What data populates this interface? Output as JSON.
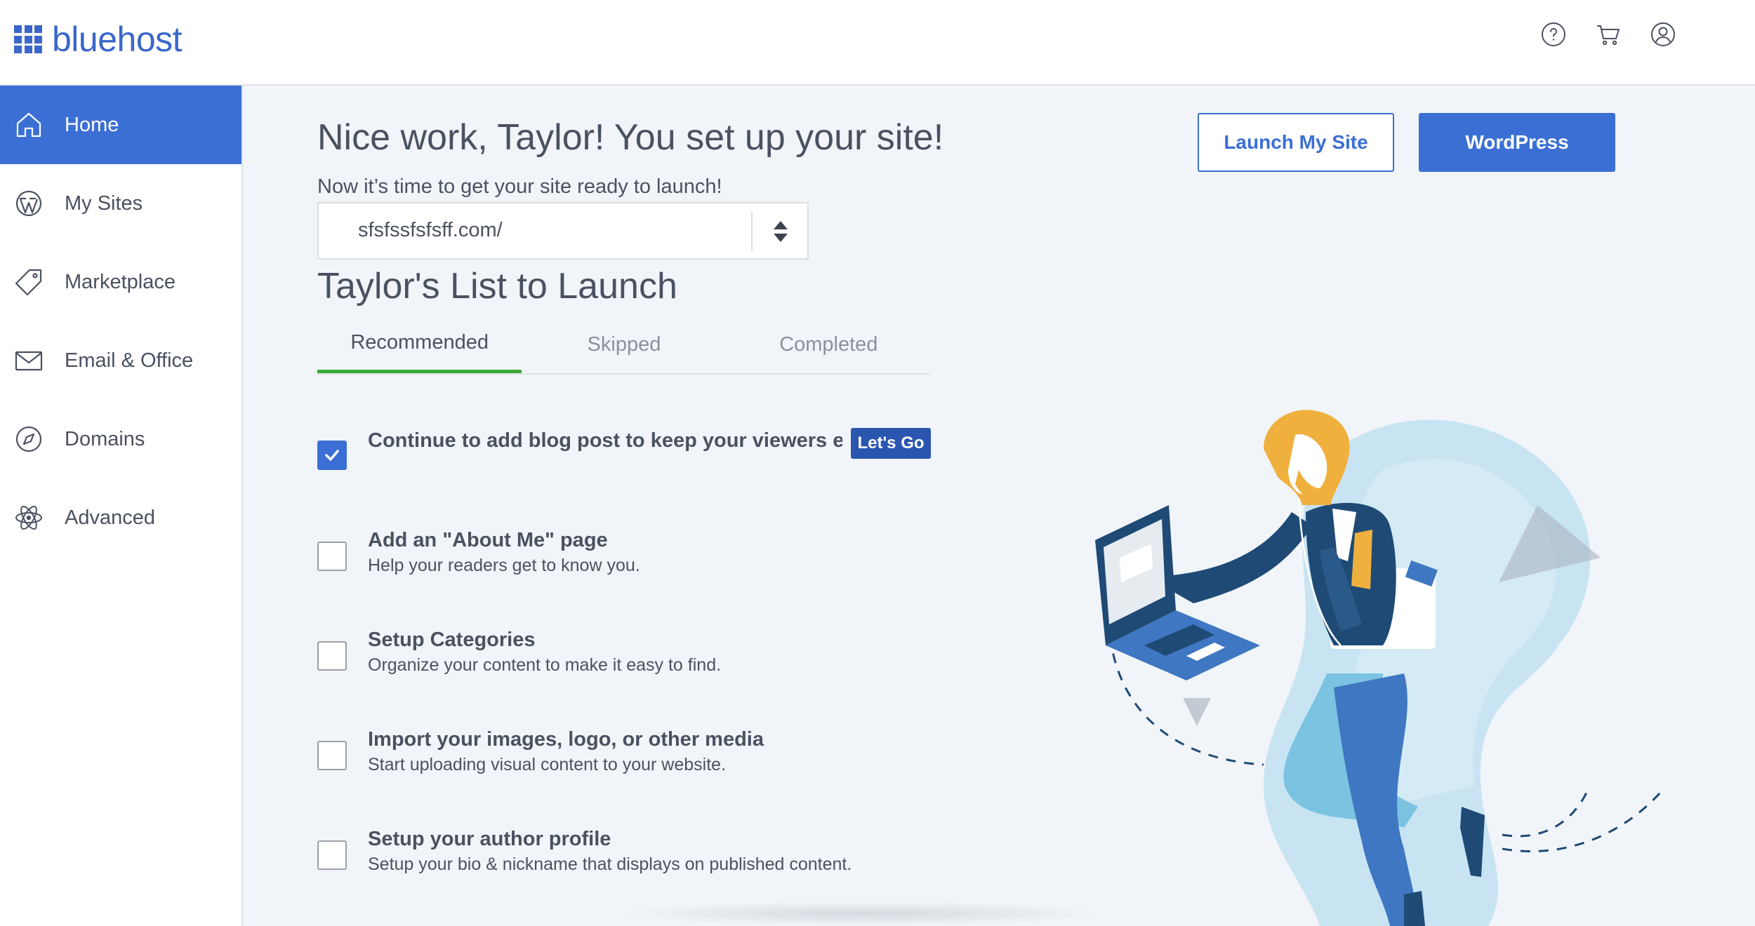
{
  "brand": {
    "name": "bluehost",
    "color": "#3a67c9"
  },
  "header": {
    "icons": [
      "help-icon",
      "cart-icon",
      "account-icon"
    ]
  },
  "sidebar": {
    "items": [
      {
        "label": "Home",
        "icon": "home-icon",
        "active": true
      },
      {
        "label": "My Sites",
        "icon": "wordpress-icon",
        "active": false
      },
      {
        "label": "Marketplace",
        "icon": "tag-icon",
        "active": false
      },
      {
        "label": "Email & Office",
        "icon": "mail-icon",
        "active": false
      },
      {
        "label": "Domains",
        "icon": "compass-icon",
        "active": false
      },
      {
        "label": "Advanced",
        "icon": "atom-icon",
        "active": false
      }
    ]
  },
  "main": {
    "title": "Nice work, Taylor! You set up your site!",
    "subtitle": "Now it’s time to get your site ready to launch!",
    "site_select": {
      "value": "sfsfssfsfsff.com/"
    },
    "buttons": {
      "launch": "Launch My Site",
      "wordpress": "WordPress"
    },
    "list_title": "Taylor's List to Launch",
    "tabs": [
      {
        "label": "Recommended",
        "active": true
      },
      {
        "label": "Skipped",
        "active": false
      },
      {
        "label": "Completed",
        "active": false
      }
    ],
    "tasks": [
      {
        "title": "Continue to add blog post to keep your viewers engaged",
        "description": "",
        "checked": true,
        "action": "Let's Go"
      },
      {
        "title": "Add an \"About Me\" page",
        "description": "Help your readers get to know you.",
        "checked": false
      },
      {
        "title": "Setup Categories",
        "description": "Organize your content to make it easy to find.",
        "checked": false
      },
      {
        "title": "Import your images, logo, or other media",
        "description": "Start uploading visual content to your website.",
        "checked": false
      },
      {
        "title": "Setup your author profile",
        "description": "Setup your bio & nickname that displays on published content.",
        "checked": false
      }
    ]
  },
  "colors": {
    "accent": "#3b6fd4",
    "tab_active": "#39a935",
    "illustration_hair": "#f0b03e",
    "illustration_navy": "#1f4a75"
  }
}
